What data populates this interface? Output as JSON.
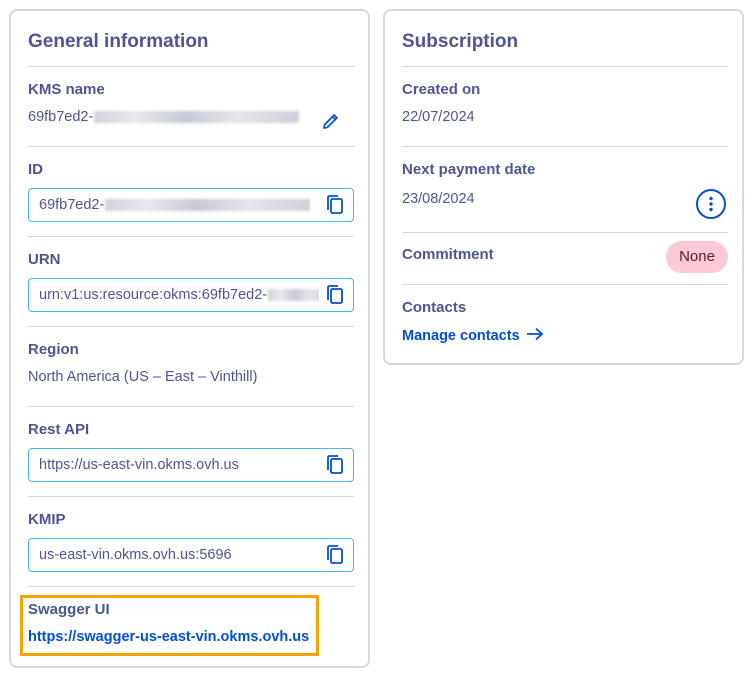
{
  "general": {
    "title": "General information",
    "kms_name": {
      "label": "KMS name",
      "value": "69fb7ed2-"
    },
    "id": {
      "label": "ID",
      "value": "69fb7ed2-"
    },
    "urn": {
      "label": "URN",
      "value": "urn:v1:us:resource:okms:69fb7ed2-"
    },
    "region": {
      "label": "Region",
      "value": "North America (US – East – Vinthill)"
    },
    "rest_api": {
      "label": "Rest API",
      "value": "https://us-east-vin.okms.ovh.us"
    },
    "kmip": {
      "label": "KMIP",
      "value": "us-east-vin.okms.ovh.us:5696"
    },
    "swagger": {
      "label": "Swagger UI",
      "link": "https://swagger-us-east-vin.okms.ovh.us"
    }
  },
  "subscription": {
    "title": "Subscription",
    "created_on": {
      "label": "Created on",
      "value": "22/07/2024"
    },
    "next_payment": {
      "label": "Next payment date",
      "value": "23/08/2024"
    },
    "commitment": {
      "label": "Commitment",
      "badge": "None"
    },
    "contacts": {
      "label": "Contacts",
      "link": "Manage contacts"
    }
  },
  "icons": {
    "edit": "pencil-icon",
    "copy": "copy-icon",
    "menu": "kebab-menu-icon",
    "arrow": "arrow-right-icon"
  },
  "colors": {
    "text": "#4d5693",
    "link": "#0050d7",
    "field_border": "#38bdea",
    "highlight": "#f5a300",
    "badge_bg": "#ffc9d6"
  }
}
